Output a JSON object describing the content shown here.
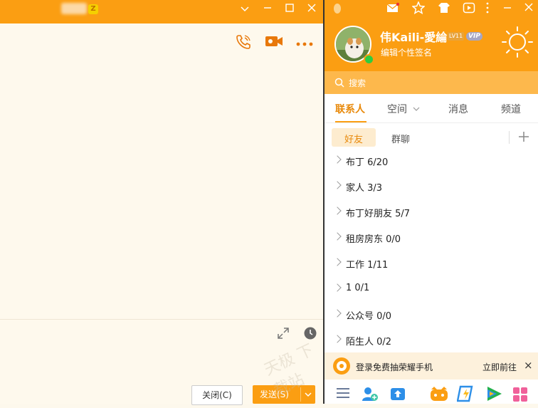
{
  "chat": {
    "title_badge_text": "Z",
    "actions": {
      "close_label": "关闭(C)",
      "send_label": "发送(S)",
      "send_dropdown": "⌄"
    }
  },
  "main": {
    "profile": {
      "name": "伟Kaili-愛綸",
      "level_badge": "LV11",
      "vip_badge": "VIP",
      "signature": "编辑个性签名"
    },
    "search": {
      "placeholder": "搜索"
    },
    "tabs": [
      {
        "label": "联系人",
        "active": true
      },
      {
        "label": "空间",
        "has_dropdown": true
      },
      {
        "label": "消息"
      },
      {
        "label": "频道"
      }
    ],
    "subtabs": [
      {
        "label": "好友",
        "active": true
      },
      {
        "label": "群聊"
      }
    ],
    "groups": [
      {
        "label": "布丁 6/20"
      },
      {
        "label": "家人 3/3"
      },
      {
        "label": "布丁好朋友 5/7"
      },
      {
        "label": "租房房东 0/0"
      },
      {
        "label": "工作 1/11"
      },
      {
        "label": "1 0/1"
      },
      {
        "label": "公众号 0/0"
      },
      {
        "label": "陌生人 0/2"
      }
    ],
    "promo": {
      "text": "登录免费抽荣耀手机",
      "action": "立即前往",
      "close": "×"
    }
  },
  "colors": {
    "accent": "#fb9e12",
    "active_tab": "#e8890a",
    "send_button": "#fb9e12"
  }
}
